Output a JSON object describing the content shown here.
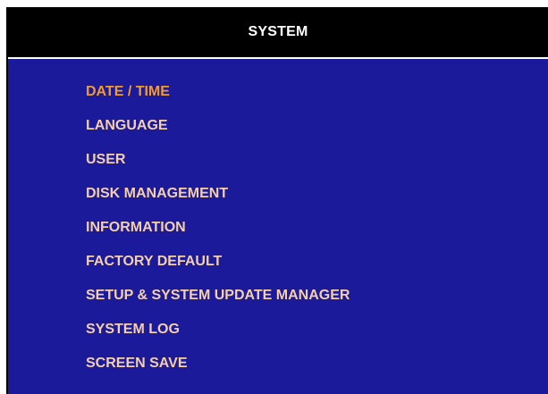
{
  "window": {
    "title": "SYSTEM"
  },
  "menu": {
    "selected_index": 0,
    "items": [
      {
        "label": "DATE / TIME"
      },
      {
        "label": "LANGUAGE"
      },
      {
        "label": "USER"
      },
      {
        "label": "DISK MANAGEMENT"
      },
      {
        "label": "INFORMATION"
      },
      {
        "label": "FACTORY DEFAULT"
      },
      {
        "label": "SETUP & SYSTEM UPDATE MANAGER"
      },
      {
        "label": "SYSTEM LOG"
      },
      {
        "label": "SCREEN SAVE"
      }
    ]
  },
  "colors": {
    "background": "#1a1a9a",
    "titlebar": "#000000",
    "item_text": "#f6cfa6",
    "item_selected": "#f29a2e",
    "title_text": "#ffffff"
  }
}
